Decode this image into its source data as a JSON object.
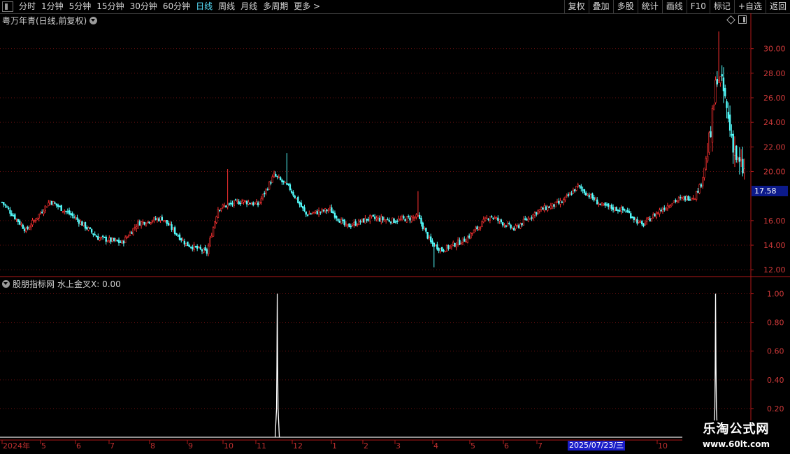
{
  "toolbar": {
    "periods": [
      "分时",
      "1分钟",
      "5分钟",
      "15分钟",
      "30分钟",
      "60分钟",
      "日线",
      "周线",
      "月线",
      "多周期",
      "更多 >"
    ],
    "active_period": "日线",
    "buttons": [
      "复权",
      "叠加",
      "多股",
      "统计",
      "画线",
      "F10",
      "标记",
      "+自选",
      "返回"
    ]
  },
  "main_chart": {
    "title": "粤万年青(日线,前复权)",
    "current_price_tag": "17.58",
    "y_ticks": [
      "30.00",
      "28.00",
      "26.00",
      "24.00",
      "22.00",
      "20.00",
      "16.00",
      "14.00",
      "12.00"
    ],
    "colors": {
      "up": "#ff3232",
      "down": "#54fcfc",
      "grid": "#6a1010",
      "axis": "#c02020"
    }
  },
  "indicator": {
    "title": "股朋指标网",
    "value_label": "水上金叉X: 0.00",
    "y_ticks": [
      "1.00",
      "0.80",
      "0.60",
      "0.40",
      "0.20"
    ]
  },
  "x_axis": {
    "labels": [
      "2024年",
      "5",
      "6",
      "7",
      "8",
      "9",
      "10",
      "11",
      "12",
      "1",
      "2",
      "3",
      "4",
      "5",
      "6",
      "7",
      "8",
      "10"
    ],
    "cursor_date": "2025/07/23/三"
  },
  "watermark": {
    "title": "乐淘公式网",
    "url": "www.60lt.com"
  },
  "chart_data": {
    "type": "candlestick",
    "main": {
      "y_range": [
        11.5,
        31.8
      ],
      "close_keypoints": [
        [
          0,
          17.5
        ],
        [
          15,
          15.2
        ],
        [
          30,
          17.6
        ],
        [
          45,
          16.3
        ],
        [
          60,
          14.6
        ],
        [
          75,
          14.2
        ],
        [
          85,
          15.8
        ],
        [
          100,
          16.2
        ],
        [
          115,
          14.1
        ],
        [
          128,
          13.4
        ],
        [
          135,
          17.0
        ],
        [
          150,
          17.6
        ],
        [
          160,
          17.3
        ],
        [
          170,
          19.7
        ],
        [
          180,
          18.6
        ],
        [
          190,
          16.5
        ],
        [
          205,
          16.9
        ],
        [
          215,
          15.5
        ],
        [
          230,
          16.2
        ],
        [
          245,
          16.0
        ],
        [
          260,
          16.3
        ],
        [
          268,
          14.2
        ],
        [
          275,
          13.6
        ],
        [
          290,
          14.5
        ],
        [
          305,
          16.4
        ],
        [
          320,
          15.3
        ],
        [
          335,
          16.8
        ],
        [
          350,
          17.5
        ],
        [
          360,
          18.8
        ],
        [
          375,
          17.2
        ],
        [
          390,
          16.8
        ],
        [
          400,
          15.6
        ],
        [
          410,
          16.7
        ],
        [
          420,
          17.6
        ],
        [
          433,
          18.0
        ],
        [
          437,
          19.0
        ],
        [
          443,
          23.0
        ],
        [
          447,
          28.0
        ],
        [
          451,
          26.5
        ],
        [
          455,
          23.5
        ],
        [
          460,
          20.6
        ],
        [
          464,
          20.0
        ]
      ],
      "spike_highs": [
        [
          141,
          20.2
        ],
        [
          178,
          21.5
        ],
        [
          260,
          18.4
        ],
        [
          448,
          31.4
        ]
      ],
      "spike_lows": [
        [
          270,
          12.2
        ]
      ]
    },
    "indicator": {
      "y_range": [
        0,
        1.1
      ],
      "signals": [
        [
          172,
          1.0
        ],
        [
          446,
          1.0
        ]
      ]
    }
  }
}
